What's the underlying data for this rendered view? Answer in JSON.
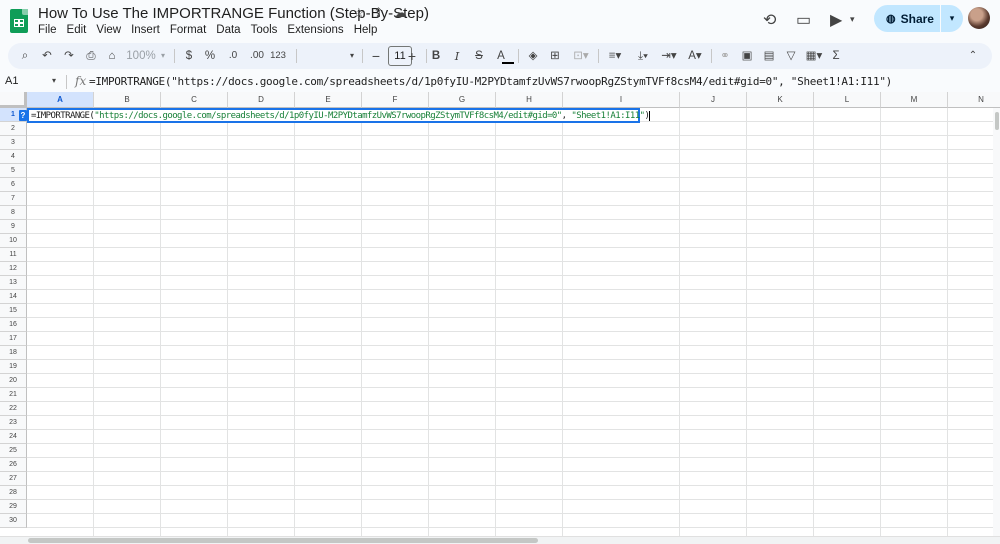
{
  "document": {
    "title": "How To Use The IMPORTRANGE Function (Step-By-Step)"
  },
  "menu": [
    "File",
    "Edit",
    "View",
    "Insert",
    "Format",
    "Data",
    "Tools",
    "Extensions",
    "Help"
  ],
  "header": {
    "share_label": "Share",
    "share_dropdown": "▾"
  },
  "toolbar": {
    "zoom": "100%",
    "currency": "$",
    "percent": "%",
    "decrease_decimal": ".0",
    "increase_decimal": ".00",
    "number_format": "123",
    "font_size": "11",
    "bold": "B",
    "italic": "I",
    "strike": "S",
    "text_color": "A",
    "sum": "Σ"
  },
  "formula_bar": {
    "name_box": "A1",
    "fx": "fx",
    "formula": "=IMPORTRANGE(\"https://docs.google.com/spreadsheets/d/1p0fyIU-M2PYDtamfzUvWS7rwoopRgZStymTVFf8csM4/edit#gid=0\", \"Sheet1!A1:I11\")"
  },
  "active_cell": {
    "help_badge": "?",
    "fn_open": "=IMPORTRANGE(",
    "url_string": "\"https://docs.google.com/spreadsheets/d/1p0fyIU-M2PYDtamfzUvWS7rwoopRgZStymTVFf8csM4/edit#gid=0\"",
    "separator": ", ",
    "range_string": "\"Sheet1!A1:I11\"",
    "fn_close": ")"
  },
  "sheet": {
    "columns": [
      "A",
      "B",
      "C",
      "D",
      "E",
      "F",
      "G",
      "H",
      "I",
      "J",
      "K",
      "L",
      "M",
      "N"
    ],
    "rows": [
      "1",
      "2",
      "3",
      "4",
      "5",
      "6",
      "7",
      "8",
      "9",
      "10",
      "11",
      "12",
      "13",
      "14",
      "15",
      "16",
      "17",
      "18",
      "19",
      "20",
      "21",
      "22",
      "23",
      "24",
      "25",
      "26",
      "27",
      "28",
      "29",
      "30"
    ],
    "selected_column": "A",
    "selected_row": "1"
  },
  "colors": {
    "selection": "#1a73e8",
    "share_bg": "#c2e7ff",
    "toolbar_bg": "#edf2fa",
    "string_green": "#188038"
  }
}
